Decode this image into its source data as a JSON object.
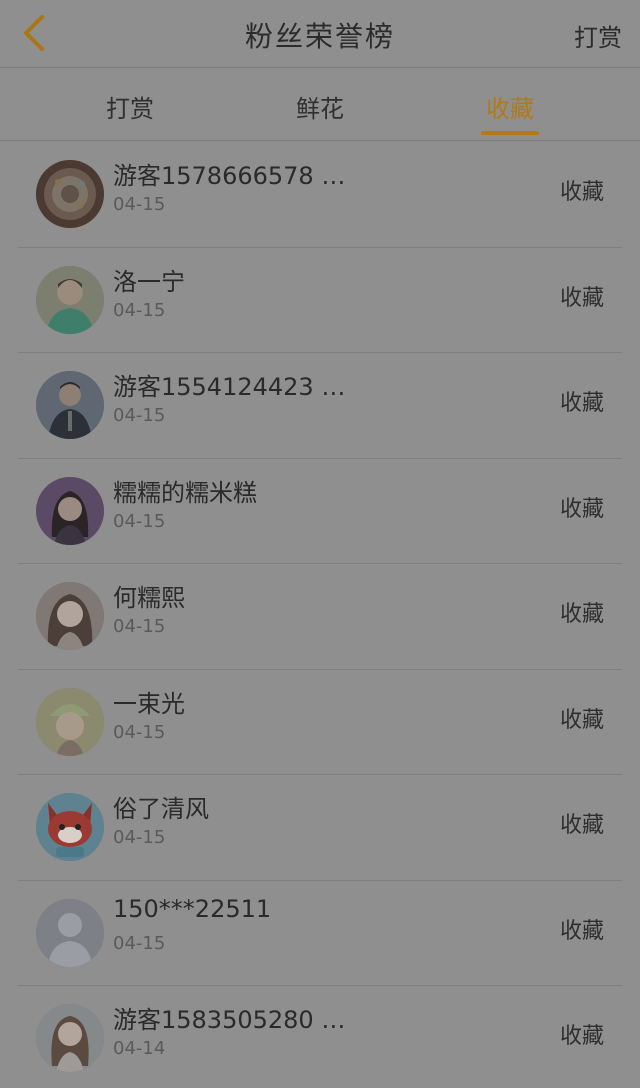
{
  "header": {
    "title": "粉丝荣誉榜",
    "action": "打赏"
  },
  "tabs": [
    {
      "label": "打赏"
    },
    {
      "label": "鲜花"
    },
    {
      "label": "收藏"
    }
  ],
  "colors": {
    "accent": "#b07a18",
    "background": "#8f8f8f"
  },
  "fans": [
    {
      "name": "游客1578666578 …",
      "date": "04-15",
      "action": "收藏",
      "avatar_icon": "cake-avatar"
    },
    {
      "name": "洛一宁",
      "date": "04-15",
      "action": "收藏",
      "avatar_icon": "person-avatar"
    },
    {
      "name": "游客1554124423 …",
      "date": "04-15",
      "action": "收藏",
      "avatar_icon": "person-avatar"
    },
    {
      "name": "糯糯的糯米糕",
      "date": "04-15",
      "action": "收藏",
      "avatar_icon": "person-avatar"
    },
    {
      "name": "何糯熙",
      "date": "04-15",
      "action": "收藏",
      "avatar_icon": "person-avatar"
    },
    {
      "name": "一束光",
      "date": "04-15",
      "action": "收藏",
      "avatar_icon": "person-avatar"
    },
    {
      "name": "俗了清风",
      "date": "04-15",
      "action": "收藏",
      "avatar_icon": "cartoon-fox-avatar"
    },
    {
      "name": "150***22511",
      "date": "04-15",
      "action": "收藏",
      "avatar_icon": "default-user-avatar"
    },
    {
      "name": "游客1583505280 …",
      "date": "04-14",
      "action": "收藏",
      "avatar_icon": "person-avatar"
    }
  ]
}
